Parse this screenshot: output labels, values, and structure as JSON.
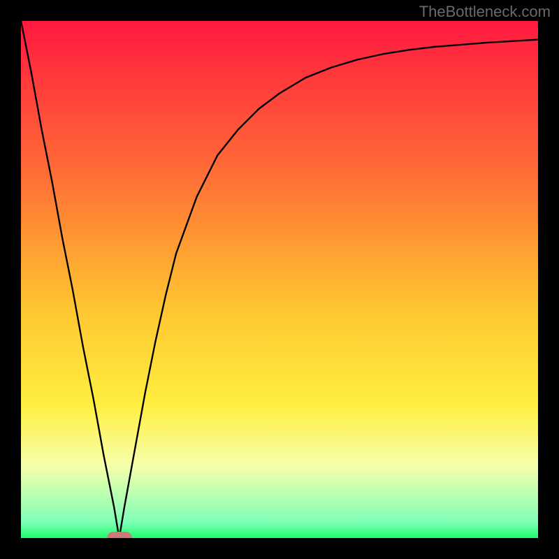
{
  "watermark": "TheBottleneck.com",
  "colors": {
    "top": "#ff193f",
    "mid_upper": "#ff6f36",
    "mid": "#ffc431",
    "mid_lower": "#ffee3f",
    "pale": "#f7ffab",
    "green": "#1cff6a",
    "curve": "#000000",
    "marker": "#cf7a76",
    "background": "#000000",
    "watermark_text": "#6a6a6a"
  },
  "chart_data": {
    "type": "line",
    "title": "",
    "xlabel": "",
    "ylabel": "",
    "xlim": [
      0,
      100
    ],
    "ylim": [
      0,
      100
    ],
    "series": [
      {
        "name": "bottleneck-curve",
        "x": [
          0,
          2,
          4,
          6,
          8,
          10,
          12,
          14,
          16,
          18,
          19,
          20,
          22,
          24,
          26,
          28,
          30,
          34,
          38,
          42,
          46,
          50,
          55,
          60,
          65,
          70,
          75,
          80,
          85,
          90,
          95,
          100
        ],
        "values": [
          100,
          90,
          79,
          69,
          58,
          48,
          37,
          27,
          16,
          6,
          0,
          6,
          17,
          28,
          38,
          47,
          55,
          66,
          74,
          79,
          83,
          86,
          89,
          91,
          92.5,
          93.6,
          94.4,
          95,
          95.4,
          95.8,
          96.1,
          96.4
        ]
      }
    ],
    "marker": {
      "x": 19,
      "y": 0
    },
    "gradient_stops": [
      {
        "pct": 0,
        "color": "#ff193f"
      },
      {
        "pct": 30,
        "color": "#ff6f36"
      },
      {
        "pct": 55,
        "color": "#ffc431"
      },
      {
        "pct": 74,
        "color": "#ffee3f"
      },
      {
        "pct": 86,
        "color": "#f7ffab"
      },
      {
        "pct": 97,
        "color": "#7dffb7"
      },
      {
        "pct": 100,
        "color": "#1cff6a"
      }
    ]
  }
}
